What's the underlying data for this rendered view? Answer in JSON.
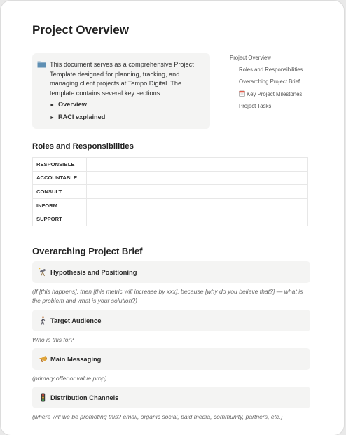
{
  "page": {
    "title": "Project Overview"
  },
  "callout": {
    "icon": "folder-icon",
    "text": "This document serves as a comprehensive Project Template designed for planning, tracking, and managing client projects at Tempo Digital. The template contains several key sections:",
    "toggles": [
      {
        "label": "Overview"
      },
      {
        "label": "RACI explained"
      }
    ]
  },
  "toc": {
    "items": [
      {
        "label": "Project Overview",
        "level": 1
      },
      {
        "label": "Roles and Responsibilities",
        "level": 2
      },
      {
        "label": "Overarching Project Brief",
        "level": 2
      },
      {
        "label": "Key Project Milestones",
        "level": 2,
        "icon": "calendar-icon"
      },
      {
        "label": "Project Tasks",
        "level": 2
      }
    ]
  },
  "roles": {
    "heading": "Roles and Responsibilities",
    "rows": [
      {
        "role": "RESPONSIBLE",
        "value": ""
      },
      {
        "role": "ACCOUNTABLE",
        "value": ""
      },
      {
        "role": "CONSULT",
        "value": ""
      },
      {
        "role": "INFORM",
        "value": ""
      },
      {
        "role": "SUPPORT",
        "value": ""
      }
    ]
  },
  "brief": {
    "heading": "Overarching Project Brief",
    "sections": [
      {
        "icon": "telescope-icon",
        "label": "Hypothesis and Positioning",
        "note": "(If [this happens], then [this metric will increase by xxx], because [why do you believe that?] — what is the problem and what is your solution?)"
      },
      {
        "icon": "person-walking-icon",
        "label": "Target Audience",
        "note": "Who is this for?"
      },
      {
        "icon": "megaphone-icon",
        "label": "Main Messaging",
        "note": "(primary offer or value prop)"
      },
      {
        "icon": "traffic-light-icon",
        "label": "Distribution Channels",
        "note": "(where will we be promoting this? email, organic social, paid media, community, partners, etc.)"
      }
    ]
  }
}
